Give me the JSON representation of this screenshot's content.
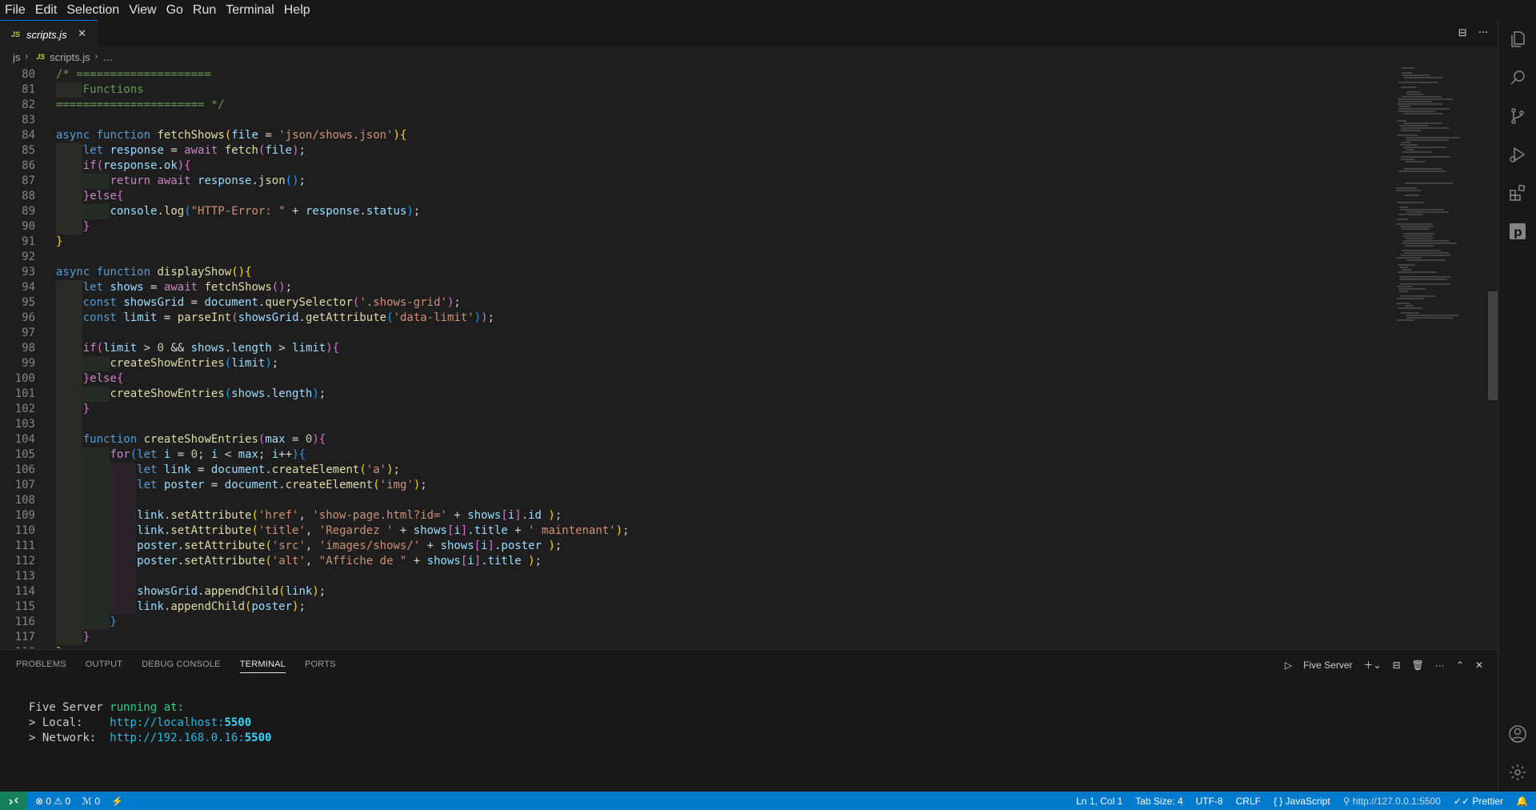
{
  "menu": [
    "File",
    "Edit",
    "Selection",
    "View",
    "Go",
    "Run",
    "Terminal",
    "Help"
  ],
  "tab": {
    "badge": "JS",
    "label": "scripts.js",
    "close": "✕"
  },
  "tab_actions": {
    "split": "⊟",
    "more": "···"
  },
  "breadcrumb": {
    "folder": "js",
    "badge": "JS",
    "file": "scripts.js",
    "ellipsis": "…"
  },
  "code_lines": [
    {
      "n": "80",
      "indent": 0,
      "html": "<span class=\"cmt\">/* ====================</span>"
    },
    {
      "n": "81",
      "indent": 1,
      "html": "<span class=\"cmt\">    Functions</span>"
    },
    {
      "n": "82",
      "indent": 0,
      "html": "<span class=\"cmt\">====================== */</span>"
    },
    {
      "n": "83",
      "indent": 0,
      "html": ""
    },
    {
      "n": "84",
      "indent": 0,
      "html": "<span class=\"kw\">async</span> <span class=\"kw\">function</span> <span class=\"fn\">fetchShows</span><span class=\"br1\">(</span><span class=\"var\">file</span> = <span class=\"str\">'json/shows.json'</span><span class=\"br1\">){</span>"
    },
    {
      "n": "85",
      "indent": 1,
      "html": "    <span class=\"kw\">let</span> <span class=\"var\">response</span> = <span class=\"ctl\">await</span> <span class=\"fn\">fetch</span><span class=\"br2\">(</span><span class=\"var\">file</span><span class=\"br2\">)</span>;"
    },
    {
      "n": "86",
      "indent": 1,
      "html": "    <span class=\"ctl\">if</span><span class=\"br2\">(</span><span class=\"var\">response</span>.<span class=\"var\">ok</span><span class=\"br2\">){</span>"
    },
    {
      "n": "87",
      "indent": 2,
      "html": "        <span class=\"ctl\">return</span> <span class=\"ctl\">await</span> <span class=\"var\">response</span>.<span class=\"fn\">json</span><span class=\"br3\">()</span>;"
    },
    {
      "n": "88",
      "indent": 1,
      "html": "    <span class=\"br2\">}</span><span class=\"ctl\">else</span><span class=\"br2\">{</span>"
    },
    {
      "n": "89",
      "indent": 2,
      "html": "        <span class=\"var\">console</span>.<span class=\"fn\">log</span><span class=\"br3\">(</span><span class=\"str\">\"HTTP-Error: \"</span> + <span class=\"var\">response</span>.<span class=\"var\">status</span><span class=\"br3\">)</span>;"
    },
    {
      "n": "90",
      "indent": 1,
      "html": "    <span class=\"br2\">}</span>"
    },
    {
      "n": "91",
      "indent": 0,
      "html": "<span class=\"br1\">}</span>"
    },
    {
      "n": "92",
      "indent": 0,
      "html": ""
    },
    {
      "n": "93",
      "indent": 0,
      "html": "<span class=\"kw\">async</span> <span class=\"kw\">function</span> <span class=\"fn\">displayShow</span><span class=\"br1\">(){</span>"
    },
    {
      "n": "94",
      "indent": 1,
      "html": "    <span class=\"kw\">let</span> <span class=\"var\">shows</span> = <span class=\"ctl\">await</span> <span class=\"fn\">fetchShows</span><span class=\"br2\">()</span>;"
    },
    {
      "n": "95",
      "indent": 1,
      "html": "    <span class=\"kw\">const</span> <span class=\"var\">showsGrid</span> = <span class=\"var\">document</span>.<span class=\"fn\">querySelector</span><span class=\"br2\">(</span><span class=\"str\">'.shows-grid'</span><span class=\"br2\">)</span>;"
    },
    {
      "n": "96",
      "indent": 1,
      "html": "    <span class=\"kw\">const</span> <span class=\"var\">limit</span> = <span class=\"fn\">parseInt</span><span class=\"br2\">(</span><span class=\"var\">showsGrid</span>.<span class=\"fn\">getAttribute</span><span class=\"br3\">(</span><span class=\"str\">'data-limit'</span><span class=\"br3\">)</span><span class=\"br2\">)</span>;"
    },
    {
      "n": "97",
      "indent": 1,
      "html": ""
    },
    {
      "n": "98",
      "indent": 1,
      "html": "    <span class=\"ctl\">if</span><span class=\"br2\">(</span><span class=\"var\">limit</span> &gt; <span class=\"num\">0</span> &amp;&amp; <span class=\"var\">shows</span>.<span class=\"var\">length</span> &gt; <span class=\"var\">limit</span><span class=\"br2\">){</span>"
    },
    {
      "n": "99",
      "indent": 2,
      "html": "        <span class=\"fn\">createShowEntries</span><span class=\"br3\">(</span><span class=\"var\">limit</span><span class=\"br3\">)</span>;"
    },
    {
      "n": "100",
      "indent": 1,
      "html": "    <span class=\"br2\">}</span><span class=\"ctl\">else</span><span class=\"br2\">{</span>"
    },
    {
      "n": "101",
      "indent": 2,
      "html": "        <span class=\"fn\">createShowEntries</span><span class=\"br3\">(</span><span class=\"var\">shows</span>.<span class=\"var\">length</span><span class=\"br3\">)</span>;"
    },
    {
      "n": "102",
      "indent": 1,
      "html": "    <span class=\"br2\">}</span>"
    },
    {
      "n": "103",
      "indent": 1,
      "html": ""
    },
    {
      "n": "104",
      "indent": 1,
      "html": "    <span class=\"kw\">function</span> <span class=\"fn\">createShowEntries</span><span class=\"br2\">(</span><span class=\"var\">max</span> = <span class=\"num\">0</span><span class=\"br2\">){</span>"
    },
    {
      "n": "105",
      "indent": 2,
      "html": "        <span class=\"ctl\">for</span><span class=\"br3\">(</span><span class=\"kw\">let</span> <span class=\"var\">i</span> = <span class=\"num\">0</span>; <span class=\"var\">i</span> &lt; <span class=\"var\">max</span>; <span class=\"var\">i</span>++<span class=\"br3\">){</span>"
    },
    {
      "n": "106",
      "indent": 3,
      "html": "            <span class=\"kw\">let</span> <span class=\"var\">link</span> = <span class=\"var\">document</span>.<span class=\"fn\">createElement</span><span class=\"br1\">(</span><span class=\"str\">'a'</span><span class=\"br1\">)</span>;"
    },
    {
      "n": "107",
      "indent": 3,
      "html": "            <span class=\"kw\">let</span> <span class=\"var\">poster</span> = <span class=\"var\">document</span>.<span class=\"fn\">createElement</span><span class=\"br1\">(</span><span class=\"str\">'img'</span><span class=\"br1\">)</span>;"
    },
    {
      "n": "108",
      "indent": 3,
      "html": ""
    },
    {
      "n": "109",
      "indent": 3,
      "html": "            <span class=\"var\">link</span>.<span class=\"fn\">setAttribute</span><span class=\"br1\">(</span><span class=\"str\">'href'</span>, <span class=\"str\">'show-page.html?id='</span> + <span class=\"var\">shows</span><span class=\"br2\">[</span><span class=\"var\">i</span><span class=\"br2\">]</span>.<span class=\"var\">id</span> <span class=\"br1\">)</span>;"
    },
    {
      "n": "110",
      "indent": 3,
      "html": "            <span class=\"var\">link</span>.<span class=\"fn\">setAttribute</span><span class=\"br1\">(</span><span class=\"str\">'title'</span>, <span class=\"str\">'Regardez '</span> + <span class=\"var\">shows</span><span class=\"br2\">[</span><span class=\"var\">i</span><span class=\"br2\">]</span>.<span class=\"var\">title</span> + <span class=\"str\">' maintenant'</span><span class=\"br1\">)</span>;"
    },
    {
      "n": "111",
      "indent": 3,
      "html": "            <span class=\"var\">poster</span>.<span class=\"fn\">setAttribute</span><span class=\"br1\">(</span><span class=\"str\">'src'</span>, <span class=\"str\">'images/shows/'</span> + <span class=\"var\">shows</span><span class=\"br2\">[</span><span class=\"var\">i</span><span class=\"br2\">]</span>.<span class=\"var\">poster</span> <span class=\"br1\">)</span>;"
    },
    {
      "n": "112",
      "indent": 3,
      "html": "            <span class=\"var\">poster</span>.<span class=\"fn\">setAttribute</span><span class=\"br1\">(</span><span class=\"str\">'alt'</span>, <span class=\"str\">\"Affiche de \"</span> + <span class=\"var\">shows</span><span class=\"br2\">[</span><span class=\"var\">i</span><span class=\"br2\">]</span>.<span class=\"var\">title</span> <span class=\"br1\">)</span>;"
    },
    {
      "n": "113",
      "indent": 3,
      "html": ""
    },
    {
      "n": "114",
      "indent": 3,
      "html": "            <span class=\"var\">showsGrid</span>.<span class=\"fn\">appendChild</span><span class=\"br1\">(</span><span class=\"var\">link</span><span class=\"br1\">)</span>;"
    },
    {
      "n": "115",
      "indent": 3,
      "html": "            <span class=\"var\">link</span>.<span class=\"fn\">appendChild</span><span class=\"br1\">(</span><span class=\"var\">poster</span><span class=\"br1\">)</span>;"
    },
    {
      "n": "116",
      "indent": 2,
      "html": "        <span class=\"br3\">}</span>"
    },
    {
      "n": "117",
      "indent": 1,
      "html": "    <span class=\"br2\">}</span>"
    },
    {
      "n": "118",
      "indent": 0,
      "html": "<span class=\"br1\">}</span>"
    }
  ],
  "panel": {
    "tabs": [
      "PROBLEMS",
      "OUTPUT",
      "DEBUG CONSOLE",
      "TERMINAL",
      "PORTS"
    ],
    "active_tab": "TERMINAL",
    "terminal_name": "Five Server",
    "terminal": {
      "line1_a": "Five Server ",
      "line1_b": "running at:",
      "local_label": "> Local:    ",
      "local_url": "http://localhost:",
      "local_port": "5500",
      "network_label": "> Network:  ",
      "network_url": "http://192.168.0.16:",
      "network_port": "5500"
    }
  },
  "status": {
    "errors": "0",
    "warnings": "0",
    "ports": "0",
    "position": "Ln 1, Col 1",
    "tab_size": "Tab Size: 4",
    "encoding": "UTF-8",
    "eol": "CRLF",
    "language": "JavaScript",
    "server_url": "http://127.0.0.1:5500",
    "formatter": "Prettier"
  },
  "colors": {
    "statusbar": "#007acc",
    "remote": "#16825d",
    "editor_bg": "#1e1e1e"
  }
}
